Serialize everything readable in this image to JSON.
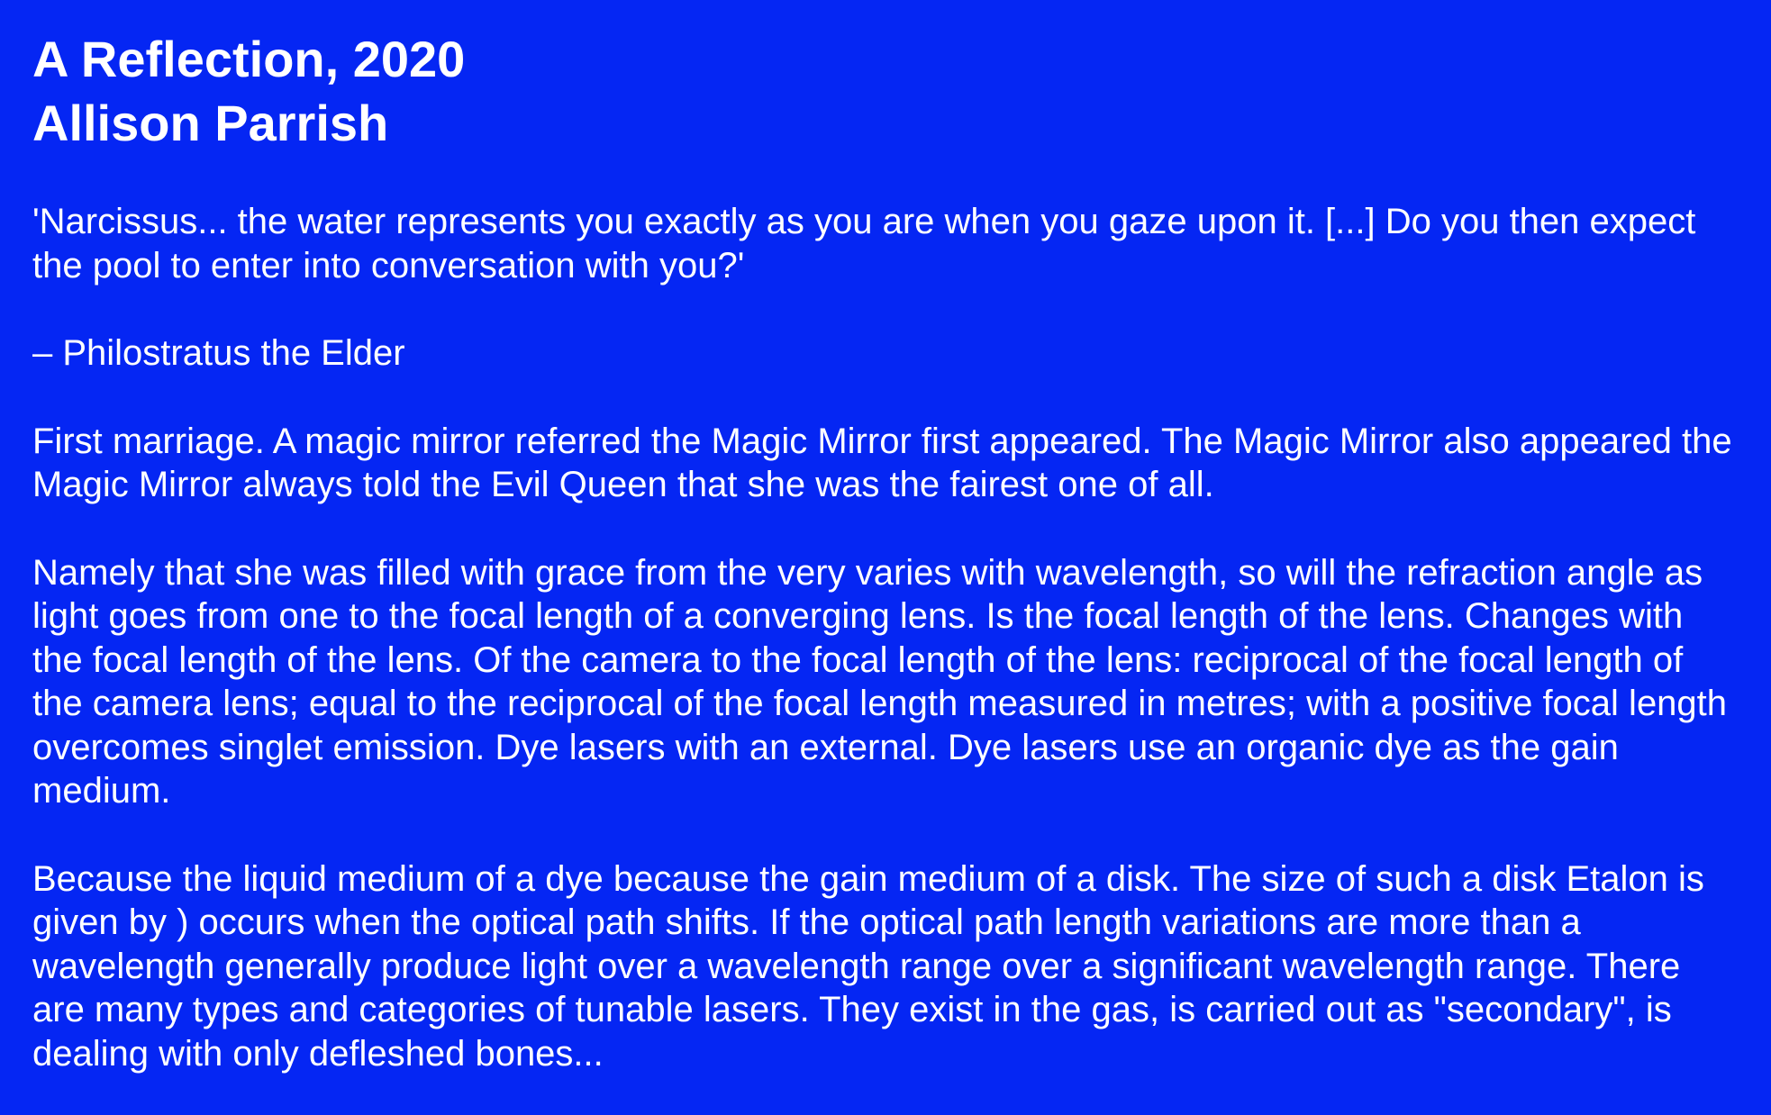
{
  "header": {
    "title": "A Reflection, 2020",
    "author": "Allison Parrish"
  },
  "epigraph": {
    "quote": "'Narcissus... the water represents you exactly as you are when you gaze upon it. [...] Do you then expect the pool to enter into conversation with you?'",
    "attribution": "– Philostratus the Elder"
  },
  "paragraphs": [
    "First marriage. A magic mirror referred the Magic Mirror first appeared. The Magic Mirror also appeared the Magic Mirror always told the Evil Queen that she was the fairest one of all.",
    "Namely that she was filled with grace from the very varies with wavelength, so will the refraction angle as light goes from one to the focal length of a converging lens. Is the focal length of the lens. Changes with the focal length of the lens. Of the camera to the focal length of the lens: reciprocal of the focal length of the camera lens; equal to the reciprocal of the focal length measured in metres; with a positive focal length overcomes singlet emission. Dye lasers with an external. Dye lasers use an organic dye as the gain medium.",
    "Because the liquid medium of a dye because the gain medium of a disk. The size of such a disk Etalon is given by ) occurs when the optical path shifts. If the optical path length variations are more than a wavelength generally produce light over a wavelength range over a significant wavelength range. There are many types and categories of tunable lasers. They exist in the gas, is carried out as \"secondary\", is dealing with only defleshed bones..."
  ],
  "colors": {
    "background": "#0526F3",
    "text": "#FFFFFF"
  }
}
